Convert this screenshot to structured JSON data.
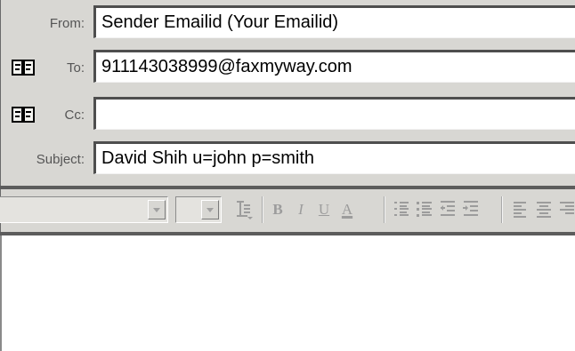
{
  "header": {
    "from": {
      "label": "From:",
      "value": "Sender Emailid (Your Emailid)"
    },
    "to": {
      "label": "To:",
      "value": "911143038999@faxmyway.com",
      "icon": "address-book-icon"
    },
    "cc": {
      "label": "Cc:",
      "value": "",
      "icon": "address-book-icon"
    },
    "subject": {
      "label": "Subject:",
      "value": "David Shih u=john p=smith"
    }
  },
  "toolbar": {
    "font_name_value": "",
    "font_size_value": "",
    "buttons": {
      "bold": "B",
      "italic": "I",
      "underline": "U",
      "font_color": "A"
    },
    "icons": [
      "paragraph-style-icon",
      "bold-icon",
      "italic-icon",
      "underline-icon",
      "font-color-icon",
      "numbered-list-icon",
      "bulleted-list-icon",
      "decrease-indent-icon",
      "increase-indent-icon",
      "align-left-icon",
      "align-center-icon"
    ]
  },
  "message_body": {
    "value": ""
  },
  "colors": {
    "panel_bg": "#d8d7d3",
    "disabled_icon": "#9c9c9c",
    "field_border": "#4e4e4e"
  }
}
